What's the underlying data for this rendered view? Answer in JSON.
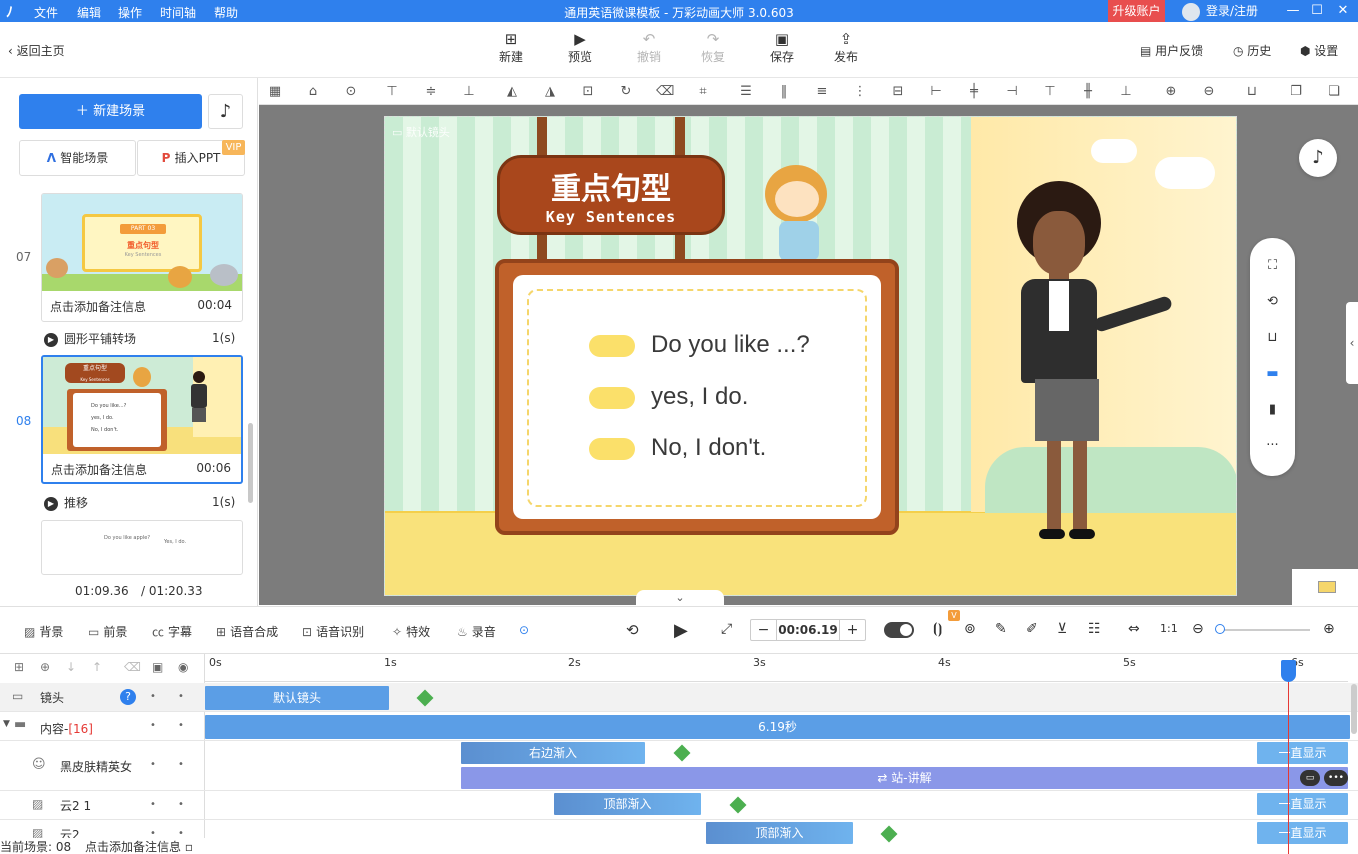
{
  "titlebar": {
    "menus": [
      "文件",
      "编辑",
      "操作",
      "时间轴",
      "帮助"
    ],
    "title": "通用英语微课模板 - 万彩动画大师 3.0.603",
    "upgrade": "升级账户",
    "login": "登录/注册"
  },
  "toolbar": {
    "back": "返回主页",
    "new": "新建",
    "preview": "预览",
    "undo": "撤销",
    "redo": "恢复",
    "save": "保存",
    "publish": "发布",
    "feedback": "用户反馈",
    "history": "历史",
    "settings": "设置"
  },
  "left": {
    "new_scene": "新建场景",
    "smart_scene": "智能场景",
    "insert_ppt": "插入PPT",
    "vip": "VIP",
    "scenes": [
      {
        "num": "07",
        "note": "点击添加备注信息",
        "dur": "00:04"
      },
      {
        "num": "08",
        "note": "点击添加备注信息",
        "dur": "00:06"
      }
    ],
    "transitions": [
      {
        "name": "圆形平铺转场",
        "dur": "1(s)"
      },
      {
        "name": "推移",
        "dur": "1(s)"
      }
    ],
    "time_current": "01:09.36",
    "time_total": "/ 01:20.33"
  },
  "thumb07": {
    "part": "PART 03",
    "title": "重点句型",
    "sub": "Key Sentences"
  },
  "thumb08": {
    "title": "重点句型",
    "sub": "Key Sentences",
    "lines": [
      "Do you like...?",
      "yes, I do.",
      "No, I don't."
    ]
  },
  "thumb09": {
    "q": "Do you like apple?",
    "a": "Yes, I do."
  },
  "stage": {
    "camera_label": "默认镜头",
    "sign_title": "重点句型",
    "sign_sub": "Key Sentences",
    "sentences": [
      "Do you like ...?",
      "yes, I do.",
      "No, I don't."
    ]
  },
  "timeline_controls": {
    "background": "背景",
    "foreground": "前景",
    "subtitle": "字幕",
    "tts": "语音合成",
    "asr": "语音识别",
    "effects": "特效",
    "record": "录音",
    "time": "00:06.19"
  },
  "timeline": {
    "ticks": [
      "0s",
      "1s",
      "2s",
      "3s",
      "4s",
      "5s",
      "6s"
    ],
    "rows": {
      "camera": "镜头",
      "content": "内容-",
      "content_count": "[16]",
      "woman": "黑皮肤精英女",
      "cloud1": "云2 1",
      "cloud2": "云2"
    },
    "bars": {
      "default_camera": "默认镜头",
      "content_total": "6.19秒",
      "enter_right": "右边渐入",
      "stand_explain": "站-讲解",
      "enter_top1": "顶部渐入",
      "enter_top2": "顶部渐入",
      "always_show": "一直显示"
    }
  },
  "status": {
    "current": "当前场景: 08",
    "note": "点击添加备注信息"
  }
}
